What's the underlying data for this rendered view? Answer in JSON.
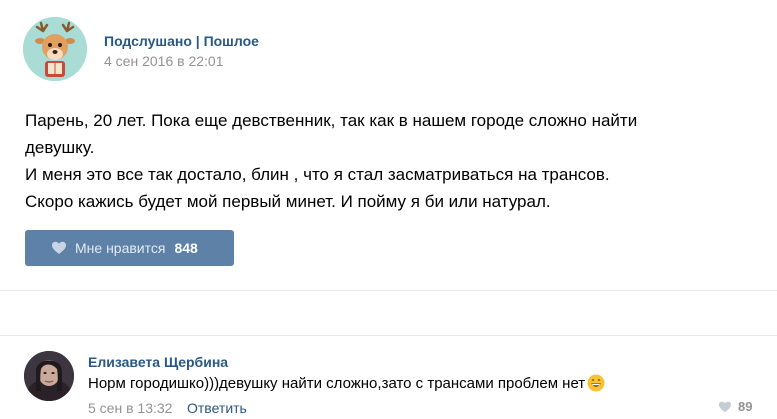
{
  "post": {
    "group_name": "Подслушано | Пошлое",
    "date": "4 сен 2016 в 22:01",
    "text_lines": [
      "Парень, 20 лет. Пока еще девственник, так как в нашем городе сложно найти",
      "девушку.",
      "И меня это все так достало, блин , что я стал засматриваться на трансов.",
      "Скоро кажись будет мой первый минет. И пойму я би или натурал."
    ],
    "like_label": "Мне нравится",
    "like_count": "848"
  },
  "comment": {
    "author": "Елизавета Щербина",
    "text": "Норм городишко)))девушку найти сложно,зато с трансами проблем нет",
    "date": "5 сен в 13:32",
    "reply_label": "Ответить",
    "like_count": "89"
  },
  "colors": {
    "link": "#2a5885",
    "like_button": "#5e81a8",
    "muted": "#939393",
    "divider": "#e7e8ec"
  },
  "icons": {
    "group_avatar": "deer-avatar",
    "like": "heart-icon",
    "emoji": "grinning-face-icon",
    "comment_like": "heart-icon"
  }
}
